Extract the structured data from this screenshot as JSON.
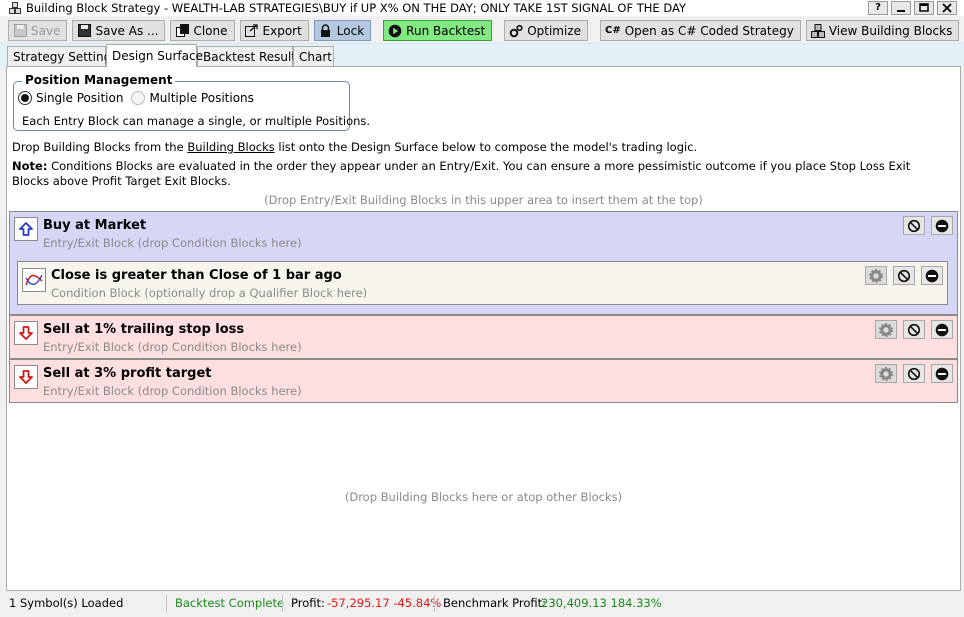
{
  "window": {
    "title": "Building Block Strategy - WEALTH-LAB STRATEGIES\\BUY if UP X% ON THE DAY; ONLY TAKE 1ST SIGNAL OF THE DAY",
    "help_label": "?"
  },
  "toolbar": {
    "save": "Save",
    "save_as": "Save As ...",
    "clone": "Clone",
    "export": "Export",
    "lock": "Lock",
    "run_backtest": "Run Backtest",
    "optimize": "Optimize",
    "open_csharp": "Open as C# Coded Strategy",
    "view_blocks": "View Building Blocks",
    "csharp_glyph": "C#"
  },
  "tabs": [
    {
      "label": "Strategy Settings"
    },
    {
      "label": "Design Surface"
    },
    {
      "label": "Backtest Results"
    },
    {
      "label": "Chart"
    }
  ],
  "position_management": {
    "title": "Position Management",
    "single": "Single Position",
    "multiple": "Multiple Positions",
    "selected": "single",
    "description": "Each Entry Block can manage a single, or multiple Positions."
  },
  "design": {
    "intro_before": "Drop Building Blocks from the ",
    "intro_link": "Building Blocks",
    "intro_after": " list onto the Design Surface below to compose the model's trading logic.",
    "note_label": "Note:",
    "note_text": " Conditions Blocks are evaluated in the order they appear under an Entry/Exit. You can ensure a more pessimistic outcome if you place Stop Loss Exit Blocks above Profit Target Exit Blocks.",
    "drop_top": "(Drop Entry/Exit Building Blocks in this upper area to insert them at the top)",
    "drop_bottom": "(Drop Building Blocks here or atop other Blocks)"
  },
  "blocks": {
    "entry": {
      "title": "Buy at Market",
      "subtitle": "Entry/Exit Block (drop Condition Blocks here)",
      "icon": "up-arrow-icon"
    },
    "condition": {
      "title": "Close is greater than Close of 1 bar ago",
      "subtitle": "Condition Block (optionally drop a Qualifier Block here)",
      "icon": "crossover-chart-icon"
    },
    "exit1": {
      "title": "Sell at 1% trailing stop loss",
      "subtitle": "Entry/Exit Block (drop Condition Blocks here)",
      "icon": "down-arrow-icon"
    },
    "exit2": {
      "title": "Sell at 3% profit target",
      "subtitle": "Entry/Exit Block (drop Condition Blocks here)",
      "icon": "down-arrow-icon"
    }
  },
  "status": {
    "symbols": "1 Symbol(s) Loaded",
    "backtest": "Backtest Complete",
    "profit_label": "Profit:",
    "profit_value": "-57,295.17 -45.84%",
    "benchmark_label": "Benchmark Profit:",
    "benchmark_value": "230,409.13 184.33%"
  },
  "colors": {
    "entry_bg": "#d6d6f6",
    "condition_bg": "#f7f5ee",
    "exit_bg": "#fedfdf",
    "run_button": "#82e882",
    "lock_button": "#b4c8e0",
    "positive": "#1a8a1a",
    "negative": "#e01818"
  }
}
